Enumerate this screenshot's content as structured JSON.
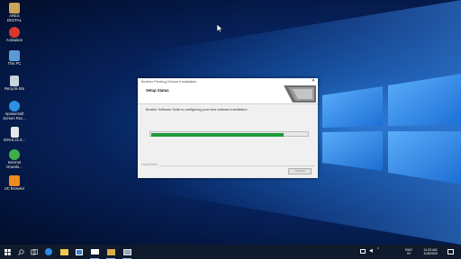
{
  "desktop": {
    "icons": [
      {
        "label": "ARES DIGITAL",
        "icon": "folder-user-icon",
        "color": "#c9a55a"
      },
      {
        "label": "Activation",
        "icon": "activation-tool-icon",
        "color": "#d73a2a"
      },
      {
        "label": "This PC",
        "icon": "computer-icon",
        "color": "#5b9bd5"
      },
      {
        "label": "Recycle Bin",
        "icon": "recycle-bin-icon",
        "color": "#c8d3dc"
      },
      {
        "label": "Apowersoft Screen Rec...",
        "icon": "screen-recorder-icon",
        "color": "#2f8fe0"
      },
      {
        "label": "IDM.6.21.0...",
        "icon": "document-icon",
        "color": "#e8e8e8"
      },
      {
        "label": "Internet Downlo...",
        "icon": "internet-download-manager-icon",
        "color": "#3fae49"
      },
      {
        "label": "UC Browser",
        "icon": "uc-browser-icon",
        "color": "#f08a1c"
      }
    ]
  },
  "dialog": {
    "title": "Brother Printing Device Installation",
    "header_title": "Setup Status",
    "status_text": "Brother Software Suite is configuring your new software installation.",
    "progress": 0.85,
    "footer_label": "InstallShield",
    "cancel_label": "Cancel"
  },
  "taskbar": {
    "items": [
      {
        "name": "start-button",
        "icon": "windows-logo-icon"
      },
      {
        "name": "search-button",
        "icon": "search-icon"
      },
      {
        "name": "task-view-button",
        "icon": "task-view-icon"
      },
      {
        "name": "taskbar-edge",
        "icon": "edge-browser-icon"
      },
      {
        "name": "taskbar-file-explorer",
        "icon": "folder-icon"
      },
      {
        "name": "taskbar-store",
        "icon": "store-icon"
      },
      {
        "name": "taskbar-mail",
        "icon": "mail-icon"
      },
      {
        "name": "taskbar-app",
        "icon": "app-icon"
      },
      {
        "name": "taskbar-installer",
        "icon": "installer-icon"
      }
    ],
    "language_line1": "ENG",
    "language_line2": "IN",
    "time": "11:25 AM",
    "date": "11/6/2020"
  },
  "colors": {
    "progress_fill": "#1d9a39",
    "taskbar_bg": "#0f1a2c"
  }
}
